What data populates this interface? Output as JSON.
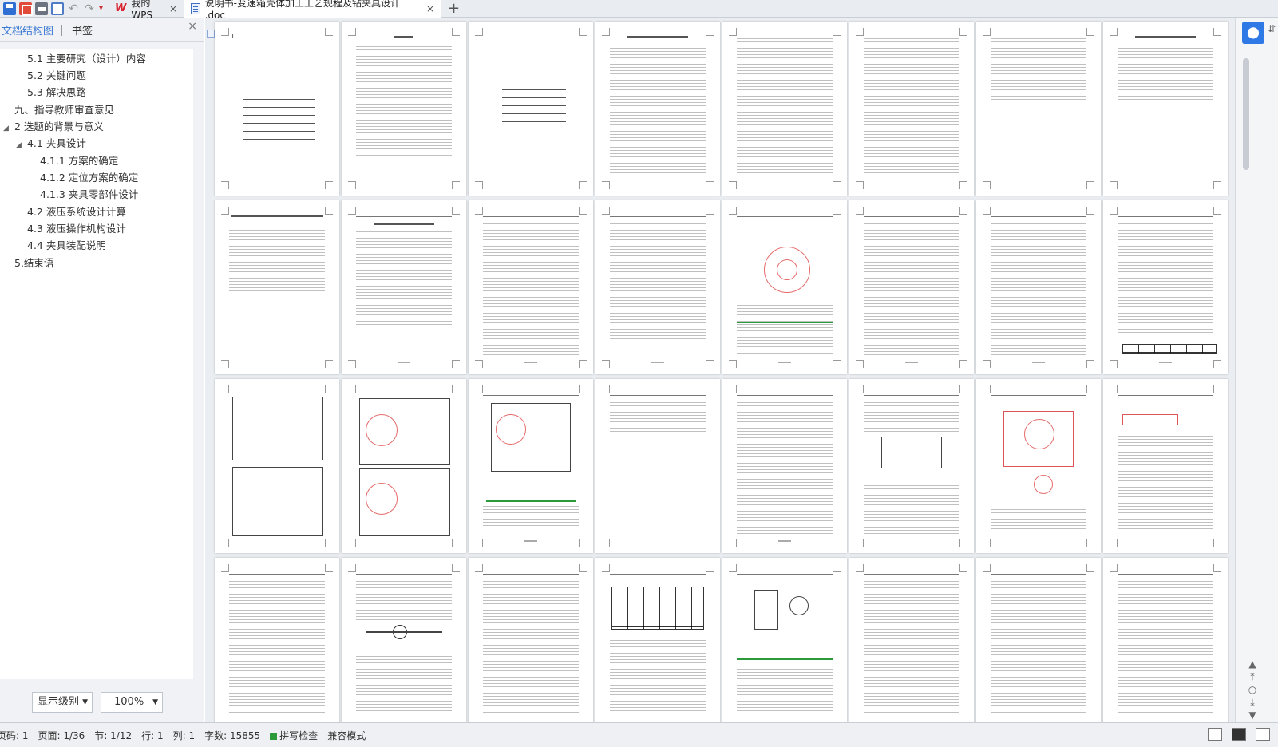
{
  "tabbar": {
    "wps_tab": "我的WPS",
    "doc_tab": "说明书-变速箱壳体加工工艺规程及钻夹具设计 .doc",
    "close_glyph": "×",
    "new_tab_glyph": "+"
  },
  "left_panel": {
    "tabs": [
      "文档结构图",
      "书签"
    ],
    "close_glyph": "×",
    "outline": [
      {
        "label": "5.1   主要研究（设计）内容",
        "indent": 2
      },
      {
        "label": "5.2   关键问题",
        "indent": 2
      },
      {
        "label": "5.3   解决思路",
        "indent": 2
      },
      {
        "label": "九、指导教师审查意见",
        "indent": 1
      },
      {
        "label": "2  选题的背景与意义",
        "indent": 0,
        "expanded": true
      },
      {
        "label": "4.1  夹具设计",
        "indent": 1,
        "expanded": true
      },
      {
        "label": "4.1.1  方案的确定",
        "indent": 3
      },
      {
        "label": "4.1.2  定位方案的确定",
        "indent": 3
      },
      {
        "label": "4.1.3  夹具零部件设计",
        "indent": 3
      },
      {
        "label": "4.2  液压系统设计计算",
        "indent": 2
      },
      {
        "label": "4.3  液压操作机构设计",
        "indent": 2
      },
      {
        "label": "4.4  夹具装配说明",
        "indent": 2
      },
      {
        "label": "5.结束语",
        "indent": 1
      }
    ],
    "level_combo": "显示级别",
    "zoom_combo": "100%"
  },
  "status_bar": {
    "page_code": "页码: 1",
    "page": "页面: 1/36",
    "section": "节: 1/12",
    "row": "行: 1",
    "col": "列: 1",
    "wordcount": "字数: 15855",
    "spell": "拼写检查",
    "compat": "兼容模式"
  },
  "colors": {
    "accent": "#2f79e6",
    "tab_active": "#ffffff",
    "panel_bg": "#f0f2f5",
    "doc_bg": "#eaedf1",
    "spell_check": "#2a9a3a"
  }
}
